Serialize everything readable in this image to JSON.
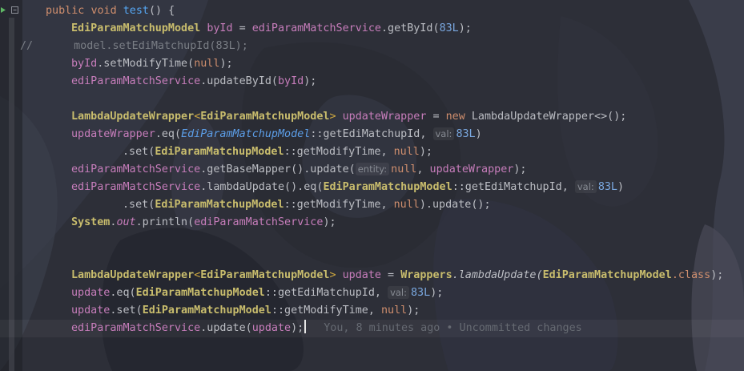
{
  "editor": {
    "comment_prefix": "//",
    "lines": {
      "l1": {
        "kw1": "public",
        "kw2": "void",
        "name": "test",
        "open": "() {"
      },
      "l2": {
        "type": "EdiParamMatchupModel",
        "var": "byId",
        "eq": " = ",
        "svc": "ediParamMatchService",
        "call": ".getById(",
        "num": "83L",
        "end": ");"
      },
      "l3": {
        "text": "model.setEdiMatchupId(83L);"
      },
      "l4": {
        "var": "byId",
        "call": ".setModifyTime(",
        "kw": "null",
        "end": ");"
      },
      "l5": {
        "svc": "ediParamMatchService",
        "call": ".updateById(",
        "var": "byId",
        "end": ");"
      },
      "l6": {
        "type": "LambdaUpdateWrapper",
        "lt": "<",
        "gen": "EdiParamMatchupModel",
        "gt": "> ",
        "var": "updateWrapper",
        "eq": " = ",
        "kw": "new",
        "ctor": " LambdaUpdateWrapper<>();"
      },
      "l7": {
        "var": "updateWrapper",
        "call": ".eq(",
        "type": "EdiParamMatchupModel",
        "ref": "::getEdiMatchupId, ",
        "hint": "val:",
        "num": "83L",
        "end": ")"
      },
      "l8": {
        "call": ".set(",
        "type": "EdiParamMatchupModel",
        "ref": "::getModifyTime, ",
        "kw": "null",
        "end": ");"
      },
      "l9": {
        "svc": "ediParamMatchService",
        "call": ".getBaseMapper().update(",
        "hint": "entity:",
        "kw": "null",
        "sep": ", ",
        "var": "updateWrapper",
        "end": ");"
      },
      "l10": {
        "svc": "ediParamMatchService",
        "call": ".lambdaUpdate().eq(",
        "type": "EdiParamMatchupModel",
        "ref": "::getEdiMatchupId, ",
        "hint": "val:",
        "num": "83L",
        "end": ")"
      },
      "l11": {
        "call": ".set(",
        "type": "EdiParamMatchupModel",
        "ref": "::getModifyTime, ",
        "kw": "null",
        "end": ").update();"
      },
      "l12": {
        "cls": "System",
        "dot": ".",
        "fld": "out",
        "call": ".println(",
        "svc": "ediParamMatchService",
        "end": ");"
      },
      "l13": {
        "type": "LambdaUpdateWrapper",
        "lt": "<",
        "gen": "EdiParamMatchupModel",
        "gt": "> ",
        "var": "update",
        "eq": " = ",
        "cls": "Wrappers",
        "call": ".lambdaUpdate(",
        "type2": "EdiParamMatchupModel",
        "dotcls": ".class",
        "end": ");"
      },
      "l14": {
        "var": "update",
        "call": ".eq(",
        "type": "EdiParamMatchupModel",
        "ref": "::getEdiMatchupId, ",
        "hint": "val:",
        "num": "83L",
        "end": ");"
      },
      "l15": {
        "var": "update",
        "call": ".set(",
        "type": "EdiParamMatchupModel",
        "ref": "::getModifyTime, ",
        "kw": "null",
        "end": ");"
      },
      "l16": {
        "svc": "ediParamMatchService",
        "call": ".update(",
        "var": "update",
        "end": ");"
      }
    },
    "blame": "You, 8 minutes ago • Uncommitted changes"
  },
  "colors": {
    "background": "#2b2d35",
    "keyword": "#cf8e6d",
    "class": "#c9bd6d",
    "variable": "#c77dbb",
    "number": "#7aa8e0",
    "text": "#bcbec4"
  }
}
